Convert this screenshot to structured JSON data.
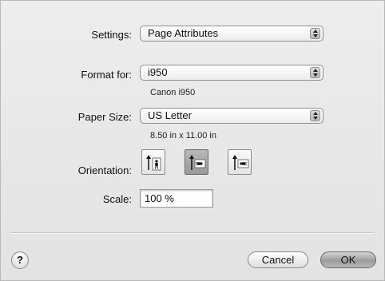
{
  "settings": {
    "label": "Settings:",
    "value": "Page Attributes"
  },
  "format_for": {
    "label": "Format for:",
    "value": "i950",
    "sub": "Canon i950"
  },
  "paper_size": {
    "label": "Paper Size:",
    "value": "US Letter",
    "sub": "8.50 in x 11.00 in"
  },
  "orientation": {
    "label": "Orientation:",
    "options": [
      {
        "name": "portrait",
        "selected": false
      },
      {
        "name": "landscape",
        "selected": true
      },
      {
        "name": "reverse-landscape",
        "selected": false
      }
    ]
  },
  "scale": {
    "label": "Scale:",
    "value": "100 %"
  },
  "buttons": {
    "help": "?",
    "cancel": "Cancel",
    "ok": "OK"
  }
}
